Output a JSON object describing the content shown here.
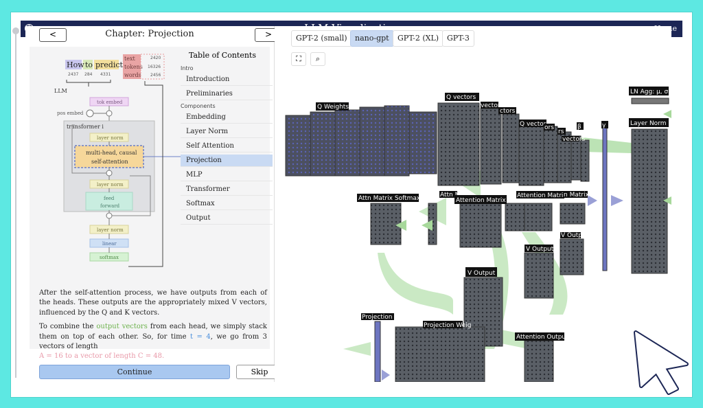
{
  "window": {
    "title": "LLM Visualization",
    "home_label": "Home",
    "help_icon": "?"
  },
  "chapter": {
    "title": "Chapter: Projection",
    "prev_label": "<",
    "next_label": ">"
  },
  "diagram": {
    "tokens": [
      "How",
      "to",
      "predict"
    ],
    "token_ids": [
      "2437",
      "284",
      "4331"
    ],
    "legend": [
      "text",
      "tokens",
      "words"
    ],
    "legend_values": [
      "2420",
      "16326",
      "2456"
    ],
    "llm_label": "LLM",
    "tok_embed": "tok embed",
    "pos_embed": "pos embed",
    "transformer_label": "transformer i",
    "layer_norm": "layer norm",
    "attention": [
      "multi-head, causal",
      "self-attention"
    ],
    "feed_forward": [
      "feed",
      "forward"
    ],
    "linear": "linear",
    "softmax": "softmax"
  },
  "toc": {
    "title": "Table of Contents",
    "groups": [
      {
        "label": "Intro",
        "items": [
          "Introduction",
          "Preliminaries"
        ]
      },
      {
        "label": "Components",
        "items": [
          "Embedding",
          "Layer Norm",
          "Self Attention",
          "Projection",
          "MLP",
          "Transformer",
          "Softmax",
          "Output"
        ]
      }
    ],
    "active": "Projection"
  },
  "text": {
    "p1": "After the self-attention process, we have outputs from each of the heads. These outputs are the appropriately mixed V vectors, influenced by the Q and K vectors.",
    "p2_a": "To combine the ",
    "p2_green": "output vectors",
    "p2_b": " from each head, we simply stack them on top of each other. So, for time ",
    "p2_t": "t = 4",
    "p2_c": ", we go from 3 vectors of length",
    "p2_d": "A = 16 to a vector of length C = 48."
  },
  "buttons": {
    "continue": "Continue",
    "skip": "Skip"
  },
  "models": [
    "GPT-2 (small)",
    "nano-gpt",
    "GPT-2 (XL)",
    "GPT-3"
  ],
  "active_model": "nano-gpt",
  "tools": {
    "fullscreen_icon": "⛶",
    "search_icon": "⌕"
  },
  "viz_labels": {
    "q_weights": "Q Weights",
    "q_vectors": "Q vectors",
    "vectors1": "vectors",
    "ctors": "ctors",
    "q_vectors2": "Q vectors",
    "ors": "ors",
    "rs": "rs",
    "beta": "β",
    "gamma": "γ",
    "vectors_small": "vectors",
    "ln_agg": "LN Agg: μ, σ",
    "layer_norm": "Layer Norm",
    "attn_softmax": "Attn Matrix Softmax",
    "attn_m": "Attn M",
    "attention_matrix": "Attention Matrix",
    "attention_matrix2": "Attention Matrix",
    "n_matrix": "n Matrix",
    "v_output": "V Output",
    "v_output2": "V Output",
    "v_output_main": "V Output",
    "projection_bias": "Projection Bias",
    "projection_weights": "Projection Weig",
    "attention_output": "Attention Output"
  },
  "colors": {
    "accent": "#5de8e2",
    "titlebar": "#1c2655",
    "active": "#c9daf3",
    "green": "#6bb14a"
  }
}
